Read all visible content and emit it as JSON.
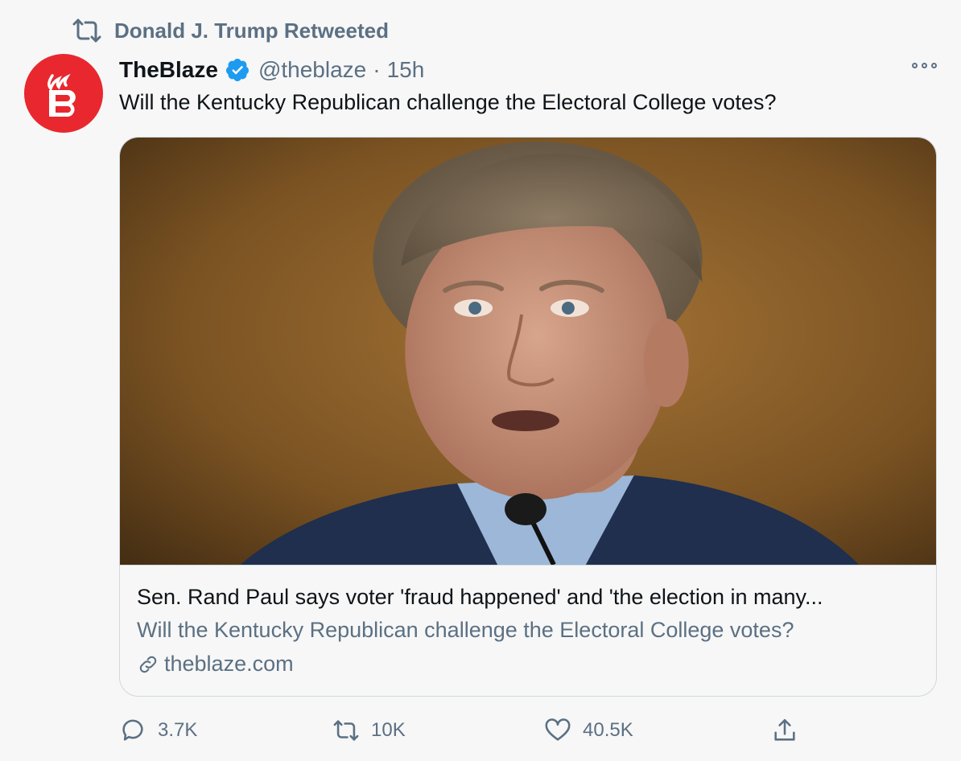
{
  "retweet_banner": {
    "text": "Donald J. Trump Retweeted",
    "icon": "retweet-icon"
  },
  "author": {
    "display_name": "TheBlaze",
    "verified": true,
    "handle": "@theblaze",
    "separator": "·",
    "time": "15h",
    "avatar_icon": "theblaze-logo",
    "avatar_color": "#e8282e"
  },
  "tweet": {
    "text": "Will the Kentucky Republican challenge the Electoral College votes?"
  },
  "card": {
    "image_icon": "article-photo",
    "title": "Sen. Rand Paul says voter 'fraud happened' and 'the election in many...",
    "description": "Will the Kentucky Republican challenge the Electoral College votes?",
    "domain": "theblaze.com",
    "domain_icon": "link-icon"
  },
  "actions": {
    "replies": "3.7K",
    "retweets": "10K",
    "likes": "40.5K"
  },
  "colors": {
    "accent": "#1d9bf0",
    "secondary_text": "#5b7083",
    "primary_text": "#0f1419",
    "background": "#f7f7f7",
    "border": "#cfd9de"
  }
}
